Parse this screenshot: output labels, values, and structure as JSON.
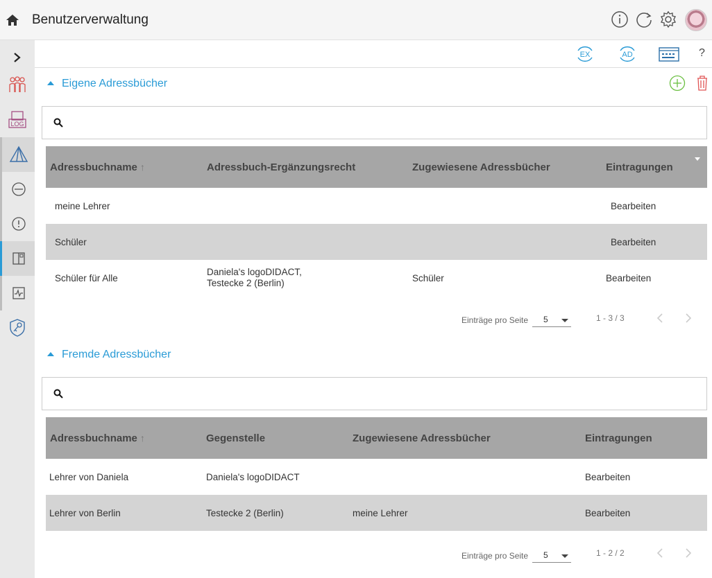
{
  "header": {
    "title": "Benutzerverwaltung"
  },
  "toolbar": {
    "help_label": "?",
    "ex_label": "EX",
    "ad_label": "AD"
  },
  "own": {
    "title": "Eigene Adressbücher",
    "columns": [
      "Adressbuchname",
      "Adressbuch-Ergänzungsrecht",
      "Zugewiesene Adressbücher",
      "Eintragungen"
    ],
    "rows": [
      [
        "meine Lehrer",
        "",
        "",
        "Bearbeiten"
      ],
      [
        "Schüler",
        "",
        "",
        "Bearbeiten"
      ],
      [
        "Schüler für Alle",
        "Daniela's logoDIDACT,",
        "Schüler",
        "Bearbeiten"
      ]
    ],
    "row3_line2": "Testecke 2 (Berlin)",
    "pager": {
      "label": "Einträge pro Seite",
      "value": "5",
      "range": "1 - 3 / 3"
    }
  },
  "foreign": {
    "title": "Fremde Adressbücher",
    "columns": [
      "Adressbuchname",
      "Gegenstelle",
      "Zugewiesene Adressbücher",
      "Eintragungen"
    ],
    "rows": [
      [
        "Lehrer von Daniela",
        "Daniela's logoDIDACT",
        "",
        "Bearbeiten"
      ],
      [
        "Lehrer von Berlin",
        "Testecke 2 (Berlin)",
        "meine Lehrer",
        "Bearbeiten"
      ]
    ],
    "pager": {
      "label": "Einträge pro Seite",
      "value": "5",
      "range": "1 - 2 / 2"
    }
  },
  "sidebar": {
    "log_label": "LOG"
  },
  "colors": {
    "accent": "#2a9bd6",
    "add": "#6abf40",
    "delete": "#e05555"
  }
}
